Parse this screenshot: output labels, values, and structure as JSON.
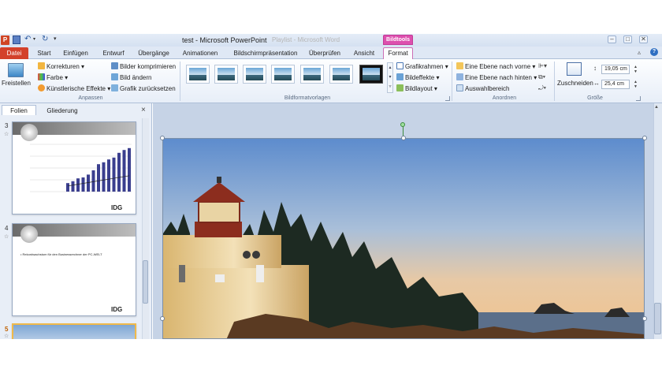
{
  "window": {
    "title": "test - Microsoft PowerPoint",
    "ghost_title": "Playlist - Microsoft Word",
    "context_header": "Bildtools",
    "controls": [
      "–",
      "□",
      "✕"
    ],
    "quick_access_icons": [
      "powerpoint-logo",
      "save-icon",
      "undo-icon",
      "repeat-icon",
      "customize-icon"
    ]
  },
  "tabs": [
    "Datei",
    "Start",
    "Einfügen",
    "Entwurf",
    "Übergänge",
    "Animationen",
    "Bildschirmpräsentation",
    "Überprüfen",
    "Ansicht",
    "Format"
  ],
  "ribbon": {
    "anpassen": {
      "label": "Anpassen",
      "freistellen": "Freistellen",
      "korrekturen": "Korrekturen",
      "farbe": "Farbe",
      "kuenstlerische": "Künstlerische Effekte",
      "komprimieren": "Bilder komprimieren",
      "aendern": "Bild ändern",
      "zuruecksetzen": "Grafik zurücksetzen"
    },
    "vorlagen": {
      "label": "Bildformatvorlagen",
      "grafikrahmen": "Grafikrahmen",
      "bildeffekte": "Bildeffekte",
      "bildlayout": "Bildlayout"
    },
    "anordnen": {
      "label": "Anordnen",
      "nach_vorne": "Eine Ebene nach vorne",
      "nach_hinten": "Eine Ebene nach hinten",
      "auswahlbereich": "Auswahlbereich"
    },
    "groesse": {
      "label": "Größe",
      "zuschneiden": "Zuschneiden",
      "height": "19,05 cm",
      "width": "25,4 cm"
    }
  },
  "left_pane": {
    "tabs": [
      "Folien",
      "Gliederung"
    ],
    "close": "×",
    "slides": [
      {
        "number": "3",
        "logo": "IDG"
      },
      {
        "number": "4",
        "bullet": "Rekordwachstum für den Businessrechner der PC-WELT",
        "logo": "IDG"
      },
      {
        "number": "5"
      }
    ],
    "chart_bars": [
      0.18,
      0.22,
      0.28,
      0.3,
      0.36,
      0.45,
      0.58,
      0.62,
      0.68,
      0.72,
      0.82,
      0.88,
      0.92
    ]
  }
}
